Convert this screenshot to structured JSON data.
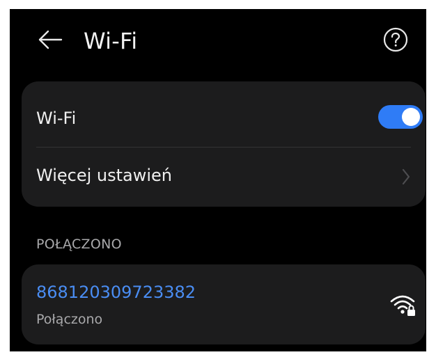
{
  "header": {
    "title": "Wi-Fi",
    "back_icon": "arrow-left-icon",
    "help_icon": "question-circle-icon"
  },
  "settings": {
    "wifi_label": "Wi-Fi",
    "wifi_enabled": true,
    "more_settings_label": "Więcej ustawień",
    "chevron_icon": "chevron-right-icon"
  },
  "connected": {
    "section_title": "POŁĄCZONO",
    "network": {
      "name": "868120309723382",
      "status": "Połączono",
      "signal_icon": "wifi-locked-icon"
    }
  },
  "colors": {
    "background": "#000000",
    "card": "#1c1c1d",
    "accent": "#2f7cf6",
    "network_name": "#4a8df3",
    "secondary_text": "#a9a9ab",
    "primary_text": "#f0f0f0"
  }
}
